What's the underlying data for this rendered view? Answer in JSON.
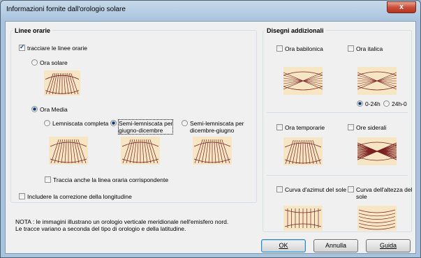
{
  "window": {
    "title": "Informazioni fornite dall'orologio solare",
    "close_label": "x"
  },
  "left_group": {
    "title": "Linee orarie",
    "draw_lines": {
      "label": "tracciare le linee orarie",
      "checked": true
    },
    "solar_time": {
      "label": "Ora solare",
      "selected": false
    },
    "mean_time": {
      "label": "Ora Media",
      "selected": true
    },
    "full_lemniscate": {
      "label": "Lemniscata completa",
      "selected": false
    },
    "semi_jun_dec": {
      "label_line1": "Semi-lemniscata per",
      "label_line2": "giugno-dicembre",
      "selected": true
    },
    "semi_dec_jun": {
      "label_line1": "Semi-lemniscata per",
      "label_line2": "dicembre-giugno",
      "selected": false
    },
    "trace_line": {
      "label": "Traccia anche la linea oraria corrispondente",
      "checked": false
    },
    "longitude": {
      "label": "Includere la correzione della longitudine",
      "checked": false
    }
  },
  "right_group": {
    "title": "Disegni addizionali",
    "babylonian": {
      "label": "Ora babilonica",
      "checked": false
    },
    "italic": {
      "label": "Ora italica",
      "checked": false
    },
    "range_0_24": {
      "label": "0-24h",
      "selected": true
    },
    "range_24_0": {
      "label": "24h-0",
      "selected": false
    },
    "temporal": {
      "label": "Ora temporarie",
      "checked": false
    },
    "sidereal": {
      "label": "Ore siderali",
      "checked": false
    },
    "azimuth": {
      "label": "Curva d'azimut del sole",
      "checked": false
    },
    "altitude": {
      "label_line1": "Curva dell'altezza del",
      "label_line2": "sole",
      "checked": false
    }
  },
  "note": {
    "line1": "NOTA : le immagini illustrano un orologio verticale meridionale nell'emisfero nord.",
    "line2": "Le tracce variano a seconda del tipo di orologio e della latitudine."
  },
  "buttons": {
    "ok": "OK",
    "cancel": "Annulla",
    "help": "Guida"
  },
  "colors": {
    "thumb_bg": "#f7e6c4",
    "line_color": "#7a2020",
    "window_border": "#4a6178"
  }
}
